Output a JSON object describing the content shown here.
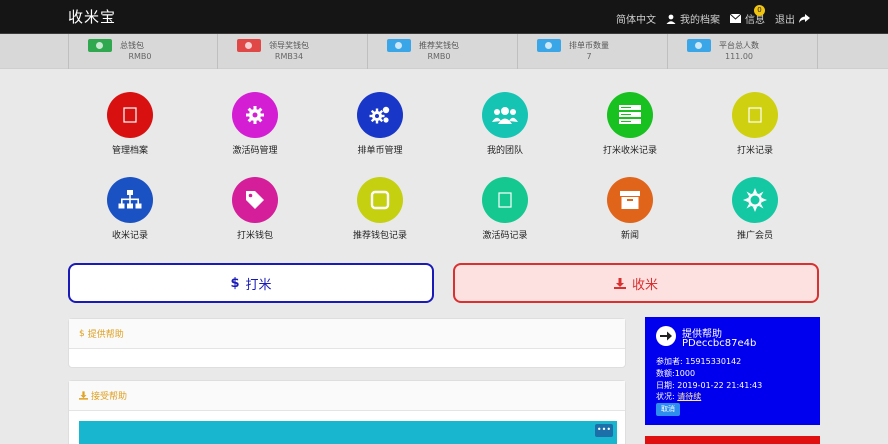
{
  "header": {
    "brand": "收米宝",
    "nav": {
      "language": "简体中文",
      "profile": "我的档案",
      "messages": "信息",
      "message_count": "0",
      "logout": "退出"
    }
  },
  "stats": [
    {
      "label": "总钱包",
      "value": "RMB0",
      "color": "#2fa84f"
    },
    {
      "label": "领导奖钱包",
      "value": "RMB34",
      "color": "#e04848"
    },
    {
      "label": "推荐奖钱包",
      "value": "RMB0",
      "color": "#3aa6e8"
    },
    {
      "label": "排单币数量",
      "value": "7",
      "color": "#3aa6e8"
    },
    {
      "label": "平台总人数",
      "value": "111.00",
      "color": "#3aa6e8"
    }
  ],
  "tiles": [
    {
      "label": "管理档案",
      "icon": "square-icon",
      "color": "#d81010"
    },
    {
      "label": "激活码管理",
      "icon": "gear-icon",
      "color": "#d41ed4"
    },
    {
      "label": "排单币管理",
      "icon": "gears-icon",
      "color": "#1836c8"
    },
    {
      "label": "我的团队",
      "icon": "users-icon",
      "color": "#16c4b4"
    },
    {
      "label": "打米收米记录",
      "icon": "server-icon",
      "color": "#18c020"
    },
    {
      "label": "打米记录",
      "icon": "square-icon",
      "color": "#cfd010"
    },
    {
      "label": "收米记录",
      "icon": "sitemap-icon",
      "color": "#1a52c4"
    },
    {
      "label": "打米钱包",
      "icon": "tag-icon",
      "color": "#d41e9a"
    },
    {
      "label": "推荐钱包记录",
      "icon": "checkbox-icon",
      "color": "#c4d010"
    },
    {
      "label": "激活码记录",
      "icon": "square-icon",
      "color": "#14c890"
    },
    {
      "label": "新闻",
      "icon": "archive-icon",
      "color": "#e0641a"
    },
    {
      "label": "推广会员",
      "icon": "sun-icon",
      "color": "#14c8a4"
    }
  ],
  "actions": {
    "give": {
      "symbol": "$",
      "label": "打米"
    },
    "receive": {
      "label": "收米"
    }
  },
  "panels": {
    "provide_help": {
      "symbol": "$",
      "title": "提供帮助"
    },
    "accept_help": {
      "title": "接受帮助"
    }
  },
  "card": {
    "title": "提供帮助",
    "id": "PDeccbc87e4b",
    "participant_label": "参加者:",
    "participant": "15915330142",
    "amount_label": "数额:",
    "amount": "1000",
    "date_label": "日期:",
    "date": "2019-01-22 21:41:43",
    "status_label": "状况:",
    "status": "请待续",
    "cancel": "取消"
  }
}
